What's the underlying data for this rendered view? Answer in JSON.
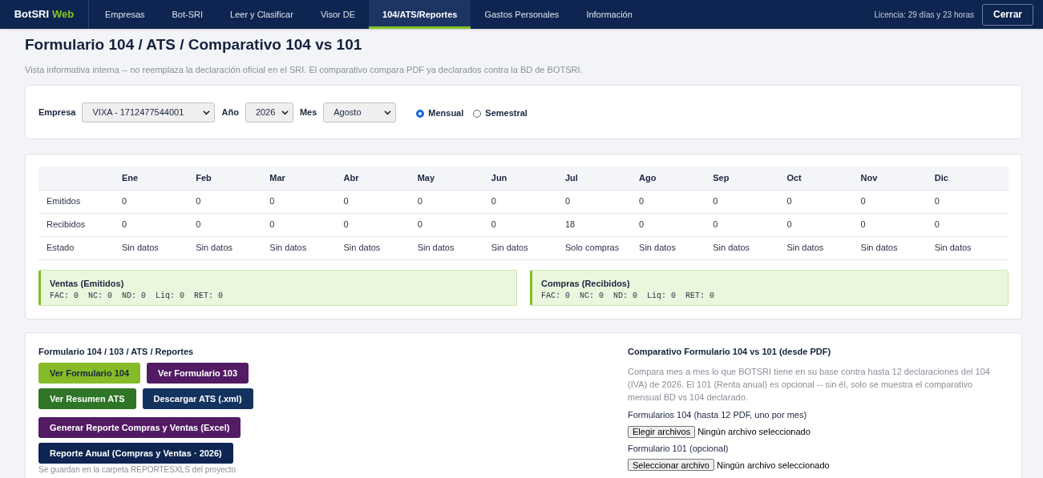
{
  "nav": {
    "brand": "BotSRI",
    "brand_accent": "Web",
    "items": [
      {
        "label": "Empresas",
        "selected": false
      },
      {
        "label": "Bot-SRI",
        "selected": false
      },
      {
        "label": "Leer y Clasificar",
        "selected": false
      },
      {
        "label": "Visor DE",
        "selected": false
      },
      {
        "label": "104/ATS/Reportes",
        "selected": true
      },
      {
        "label": "Gastos Personales",
        "selected": false
      },
      {
        "label": "Información",
        "selected": false
      }
    ],
    "license": "Licencia: 29 días y 23 horas",
    "close_button": "Cerrar"
  },
  "page": {
    "title": "Formulario 104 / ATS / Comparativo 104 vs 101",
    "subtitle": "Vista informativa interna -- no reemplaza la declaración oficial en el SRI. El comparativo compara PDF ya declarados contra la BD de BOTSRI."
  },
  "filters": {
    "fields": [
      {
        "label": "Empresa",
        "value": "VIXA - 1712477544001"
      },
      {
        "label": "Año",
        "value": "2026"
      },
      {
        "label": "Mes",
        "value": "Agosto"
      }
    ],
    "periods": [
      {
        "label": "Mensual",
        "selected": true
      },
      {
        "label": "Semestral",
        "selected": false
      }
    ]
  },
  "summary_table": {
    "columns": [
      "",
      "Ene",
      "Feb",
      "Mar",
      "Abr",
      "May",
      "Jun",
      "Jul",
      "Ago",
      "Sep",
      "Oct",
      "Nov",
      "Dic"
    ],
    "rows": [
      [
        "Emitidos",
        "0",
        "0",
        "0",
        "0",
        "0",
        "0",
        "0",
        "0",
        "0",
        "0",
        "0",
        "0"
      ],
      [
        "Recibidos",
        "0",
        "0",
        "0",
        "0",
        "0",
        "0",
        "18",
        "0",
        "0",
        "0",
        "0",
        "0"
      ],
      [
        "Estado",
        "Sin datos",
        "Sin datos",
        "Sin datos",
        "Sin datos",
        "Sin datos",
        "Sin datos",
        "Solo compras",
        "Sin datos",
        "Sin datos",
        "Sin datos",
        "Sin datos",
        "Sin datos"
      ]
    ]
  },
  "totals": [
    {
      "title": "Ventas (Emitidos)",
      "line": "FAC: 0  NC: 0  ND: 0  Liq: 0  RET: 0"
    },
    {
      "title": "Compras (Recibidos)",
      "line": "FAC: 0  NC: 0  ND: 0  Liq: 0  RET: 0"
    }
  ],
  "reports": {
    "title": "Formulario 104 / 103 / ATS / Reportes",
    "button_rows": [
      [
        {
          "label": "Ver Formulario 104",
          "color": "#84bb26"
        },
        {
          "label": "Ver Formulario 103",
          "color": "#521b63"
        }
      ],
      [
        {
          "label": "Ver Resumen ATS",
          "color": "#2e7527"
        },
        {
          "label": "Descargar ATS (.xml)",
          "color": "#12335e"
        }
      ],
      [
        {
          "label": "Generar Reporte Compras y Ventas (Excel)",
          "color": "#521b63"
        }
      ],
      [
        {
          "label": "Reporte Anual (Compras y Ventas · 2026)",
          "color": "#0d2550"
        }
      ]
    ],
    "note": "Se guardan en la carpeta REPORTESXLS del proyecto"
  },
  "comparison": {
    "title": "Comparativo Formulario 104 vs 101 (desde PDF)",
    "description": "Compara mes a mes lo que BOTSRI tiene en su base contra hasta 12 declaraciones del 104 (IVA) de 2026. El 101 (Renta anual) es opcional -- sin él, solo se muestra el comparativo mensual BD vs 104 declarado.",
    "uploads": [
      {
        "label": "Formularios 104 (hasta 12 PDF, uno por mes)",
        "button": "Elegir archivos",
        "status": "Ningún archivo seleccionado"
      },
      {
        "label": "Formulario 101 (opcional)",
        "button": "Seleccionar archivo",
        "status": "Ningún archivo seleccionado"
      }
    ]
  }
}
